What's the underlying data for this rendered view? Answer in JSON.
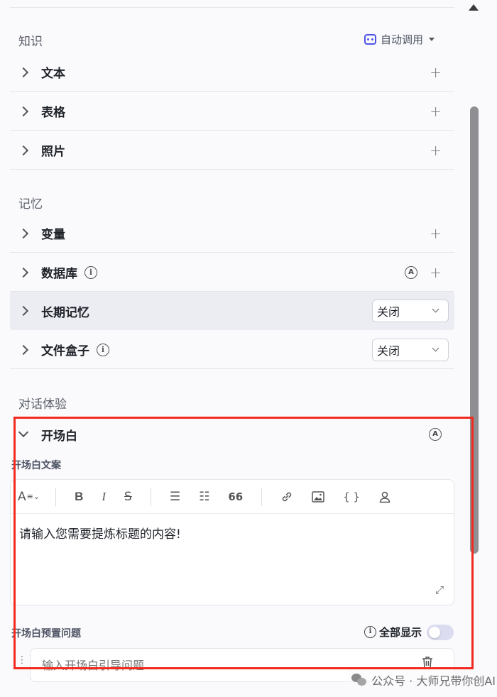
{
  "knowledge": {
    "title": "知识",
    "autocall_label": "自动调用",
    "items": [
      {
        "label": "文本"
      },
      {
        "label": "表格"
      },
      {
        "label": "照片"
      }
    ]
  },
  "memory": {
    "title": "记忆",
    "items": [
      {
        "label": "变量"
      },
      {
        "label": "数据库"
      },
      {
        "label": "长期记忆",
        "select": "关闭"
      },
      {
        "label": "文件盒子",
        "select": "关闭"
      }
    ]
  },
  "dialog": {
    "title": "对话体验",
    "opening": {
      "label": "开场白",
      "copy_label": "开场白文案",
      "toolbar": {
        "font": "A",
        "bold": "B",
        "italic": "I",
        "strike": "S",
        "quote": "66",
        "braces": "{ }"
      },
      "text": "请输入您需要提炼标题的内容!",
      "preset_label": "开场白预置问题",
      "show_all_label": "全部显示",
      "question_placeholder": "输入开场白引导问题"
    }
  },
  "badges": {
    "info": "i",
    "auto": "A",
    "plus": "+"
  },
  "watermark": "公众号 · 大师兄带你创AI",
  "colors": {
    "accent": "#4d53e8",
    "highlight_box": "#f22a1f"
  }
}
